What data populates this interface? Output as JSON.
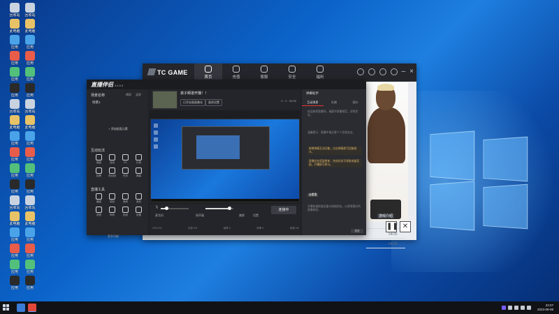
{
  "desktop": {
    "icons": [
      {
        "name": "recycle-bin-icon",
        "color": "#c9d3df",
        "label": "回收站"
      },
      {
        "name": "folder-icon",
        "color": "#e8c266",
        "label": "此电脑"
      },
      {
        "name": "app-icon",
        "color": "#4aa3e8",
        "label": "应用"
      },
      {
        "name": "app-icon",
        "color": "#e85c4a",
        "label": "应用"
      },
      {
        "name": "app-icon",
        "color": "#52c07a",
        "label": "应用"
      },
      {
        "name": "app-icon",
        "color": "#2a2a2a",
        "label": "应用"
      }
    ]
  },
  "tc": {
    "logo": "TC GAME",
    "nav": [
      "首页",
      "充值",
      "客服",
      "安全",
      "福利"
    ],
    "active_nav": 0,
    "more": "更多",
    "rows": [
      "08/07",
      "08/06",
      "08/05",
      "07/16",
      "07/15",
      "05/16",
      "05/09",
      "04/30",
      "04/24"
    ],
    "poster_tag": "游戏介绍"
  },
  "stream": {
    "logo": "直播伴侣",
    "version": "4.1.0.3",
    "left": {
      "scene_label": "场景名称",
      "scene_tab_a": "横屏",
      "scene_tab_b": "竖屏",
      "scene_item": "场景1",
      "add_source": "+ 添加画面元素",
      "interact_title": "互动玩法",
      "tools_title": "直播工具",
      "interact_tools": [
        "福袋",
        "连线",
        "PK",
        "礼物",
        "投票",
        "粉丝团",
        "任务",
        "弹幕"
      ],
      "live_tools": [
        "截图",
        "录制",
        "美颜",
        "音效",
        "滤镜",
        "特效",
        "贴纸",
        "设置"
      ],
      "more_fn": "更多功能"
    },
    "main": {
      "title": "孩子频道开播！！",
      "chip_a": "已开启画面美化",
      "chip_b": "画质设置",
      "stats": "0 · 0 · 00:00",
      "mic_label": "麦克风",
      "speaker_label": "扬声器",
      "mic_level": 0.2,
      "speaker_level": 0.85,
      "beauty_label": "美颜",
      "settings_label": "设置",
      "go_live": "连接中",
      "status": [
        "CPU 0%",
        "内存 0%",
        "帧率 0",
        "码率 0",
        "丢帧 0%"
      ]
    },
    "right": {
      "panel_title": "弹幕助手",
      "tabs": [
        "互动消息",
        "礼物",
        "观众"
      ],
      "messages": [
        {
          "text": "欢迎来到直播间，请遵守直播规范，文明发言。",
          "hl": false
        },
        {
          "text": "温馨提示：直播中请注意个人信息安全。",
          "hl": false
        },
        {
          "text": "新增弹幕互动功能，点击弹幕即可回复观众。",
          "hl": true
        },
        {
          "text": "直播任务奖励更新，完成任务可领取流量奖励，开播即可参与。",
          "hl": true
        },
        {
          "text": "开播前请检查设备与网络状态，以获得更好的直播体验。",
          "hl": false
        }
      ],
      "chip_btn": "去看看",
      "send": "发送"
    }
  },
  "taskbar": {
    "time": "23:27",
    "date": "2023-08-08"
  }
}
